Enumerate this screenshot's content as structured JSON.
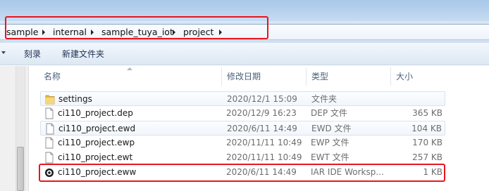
{
  "breadcrumb": {
    "items": [
      "sample",
      "internal",
      "sample_tuya_iot",
      "project"
    ]
  },
  "toolbar": {
    "burn_label": "刻录",
    "new_folder_label": "新建文件夹"
  },
  "columns": {
    "name": "名称",
    "modified": "修改日期",
    "type": "类型",
    "size": "大小"
  },
  "files": [
    {
      "name": "settings",
      "modified": "2020/12/1 15:09",
      "type": "文件夹",
      "size": "",
      "icon": "folder-icon"
    },
    {
      "name": "ci110_project.dep",
      "modified": "2020/12/9 16:23",
      "type": "DEP 文件",
      "size": "365 KB",
      "icon": "document-icon"
    },
    {
      "name": "ci110_project.ewd",
      "modified": "2020/6/11 14:49",
      "type": "EWD 文件",
      "size": "104 KB",
      "icon": "document-icon"
    },
    {
      "name": "ci110_project.ewp",
      "modified": "2020/11/11 10:49",
      "type": "EWP 文件",
      "size": "170 KB",
      "icon": "document-icon"
    },
    {
      "name": "ci110_project.ewt",
      "modified": "2020/11/11 10:49",
      "type": "EWT 文件",
      "size": "257 KB",
      "icon": "document-icon"
    },
    {
      "name": "ci110_project.eww",
      "modified": "2020/6/11 14:49",
      "type": "IAR IDE Worksp...",
      "size": "1 KB",
      "icon": "iar-workspace-icon"
    }
  ],
  "colors": {
    "annotation_red": "#e8161e",
    "header_text": "#4c607a",
    "secondary_text": "#6d6d6d"
  }
}
